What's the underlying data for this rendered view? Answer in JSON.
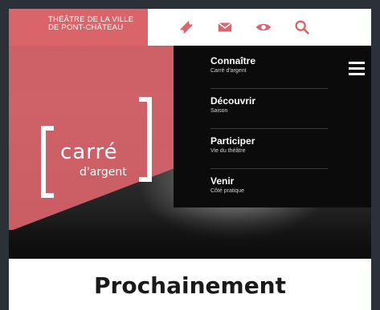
{
  "header": {
    "org_name_line1": "THÉÂTRE DE LA VILLE",
    "org_name_line2": "DE PONT-CHÂTEAU",
    "icons": [
      "ticket-icon",
      "mail-icon",
      "eye-icon",
      "search-icon"
    ]
  },
  "logo": {
    "word": "carré",
    "sub": "d'argent"
  },
  "menu": {
    "items": [
      {
        "title": "Connaître",
        "subtitle": "Carré d'argent"
      },
      {
        "title": "Découvrir",
        "subtitle": "Saison"
      },
      {
        "title": "Participer",
        "subtitle": "Vie du théâtre"
      },
      {
        "title": "Venir",
        "subtitle": "Côté pratique"
      }
    ]
  },
  "main": {
    "section_title": "Prochainement"
  },
  "colors": {
    "brand_pink": "#d9646a",
    "menu_bg": "#0b0b0b",
    "page_bg": "#2c3138"
  }
}
